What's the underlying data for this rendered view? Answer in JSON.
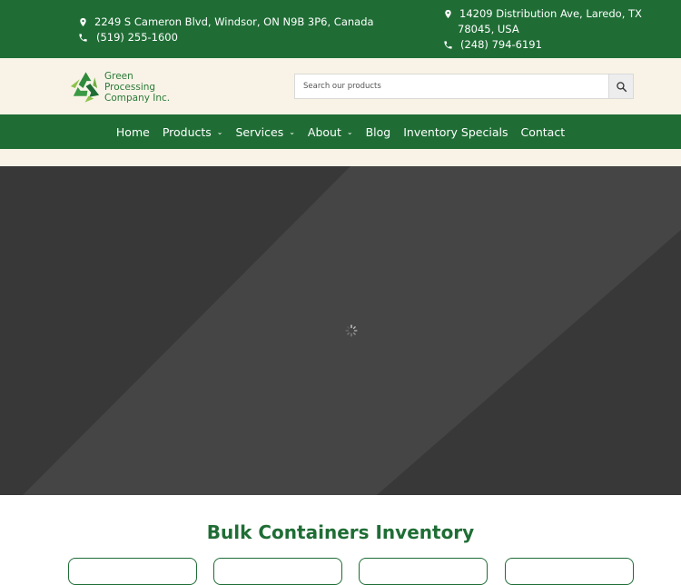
{
  "topbar": {
    "left": {
      "address": "2249 S Cameron Blvd, Windsor, ON N9B 3P6, Canada",
      "phone": "(519) 255-1600"
    },
    "right": {
      "address_line1": "14209 Distribution Ave, Laredo, TX",
      "address_line2": "78045, USA",
      "phone": "(248) 794-6191"
    }
  },
  "logo": {
    "line1": "Green Processing",
    "line2": "Company Inc."
  },
  "search": {
    "placeholder": "Search our products"
  },
  "nav": {
    "items": [
      {
        "label": "Home",
        "has_dropdown": false
      },
      {
        "label": "Products",
        "has_dropdown": true
      },
      {
        "label": "Services",
        "has_dropdown": true
      },
      {
        "label": "About",
        "has_dropdown": true
      },
      {
        "label": "Blog",
        "has_dropdown": false
      },
      {
        "label": "Inventory Specials",
        "has_dropdown": false
      },
      {
        "label": "Contact",
        "has_dropdown": false
      }
    ],
    "chevron": "⌄"
  },
  "section": {
    "title": "Bulk Containers Inventory"
  },
  "colors": {
    "brand_green": "#1f6d35",
    "cream": "#f8f3e6",
    "hero_dark": "#383838",
    "hero_light": "#454545"
  }
}
